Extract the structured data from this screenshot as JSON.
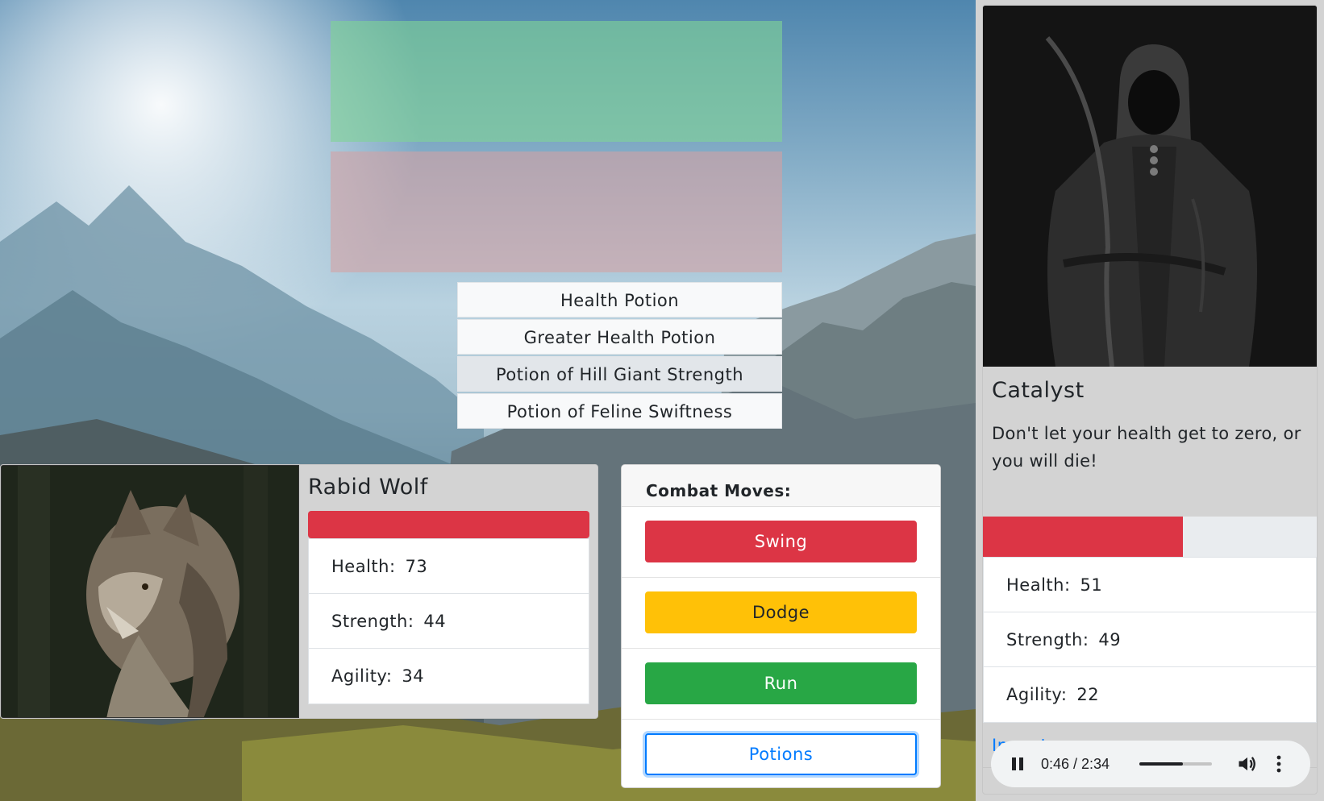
{
  "colors": {
    "danger": "#dc3545",
    "warning": "#ffc107",
    "success": "#28a745",
    "primary": "#007bff",
    "card_bg": "#d3d3d3",
    "top_bar_green": "rgba(128,212,150,0.62)",
    "top_bar_red": "rgba(214,160,162,0.58)"
  },
  "background": {
    "icon": "mountain-landscape"
  },
  "potions": {
    "items": [
      {
        "label": "Health Potion",
        "active": false
      },
      {
        "label": "Greater Health Potion",
        "active": false
      },
      {
        "label": "Potion of Hill Giant Strength",
        "active": true
      },
      {
        "label": "Potion of Feline Swiftness",
        "active": false
      }
    ]
  },
  "enemy": {
    "name": "Rabid Wolf",
    "image_icon": "wolf-portrait",
    "health_fraction": 1.0,
    "stats": [
      {
        "label": "Health:",
        "value": "73"
      },
      {
        "label": "Strength:",
        "value": "44"
      },
      {
        "label": "Agility:",
        "value": "34"
      }
    ]
  },
  "combat": {
    "header": "Combat Moves:",
    "moves": [
      {
        "label": "Swing",
        "style": "red"
      },
      {
        "label": "Dodge",
        "style": "yellow"
      },
      {
        "label": "Run",
        "style": "green"
      },
      {
        "label": "Potions",
        "style": "outline"
      }
    ]
  },
  "player": {
    "name": "Catalyst",
    "image_icon": "armored-warrior-portrait",
    "description": "Don't let your health get to zero, or you will die!",
    "health_fraction": 0.6,
    "stats": [
      {
        "label": "Health:",
        "value": "51"
      },
      {
        "label": "Strength:",
        "value": "49"
      },
      {
        "label": "Agility:",
        "value": "22"
      }
    ],
    "inventory_label": "Inventory"
  },
  "audio": {
    "current_time": "0:46",
    "duration": "2:34",
    "time_text": "0:46 / 2:34",
    "progress_fraction": 0.6,
    "play_icon": "pause-icon",
    "volume_icon": "volume-icon",
    "menu_icon": "more-vert-icon"
  }
}
